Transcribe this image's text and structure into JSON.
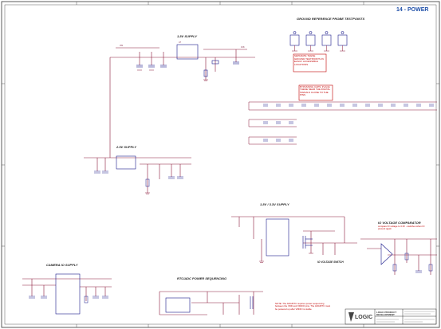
{
  "sheet": {
    "title": "14 - POWER",
    "border_color": "#333333",
    "wire_color": "#8b1a3a",
    "part_color": "#1a1a8b",
    "note_color": "#c00000",
    "title_color": "#1f4fa8"
  },
  "sections": {
    "supply_1_8v": "1.8V SUPPLY",
    "supply_2_5v": "2.5V SUPPLY",
    "supply_1_8v_3_3v": "1.8V / 3.3V SUPPLY",
    "camera_io": "CAMERA IO SUPPLY",
    "io_voltage_comparator": "IO VOLTAGE COMPARATOR",
    "io_voltage_switch": "IO VOLTAGE SWITCH",
    "rtc_power_seq": "RTC/ADC POWER SEQUENCING",
    "ground_reference": "GROUND REFERENCE PROBE TESTPOINTS"
  },
  "notes": {
    "ground_note": "SEPARATE THESE GROUND TESTPOINTS IN EASILY ACCESSIBLE LOCATIONS",
    "bypass_note": "BYPASSING CAPS: PLACE THESE NEAR THE DIGITAL SIGNALS CLOSE TO THE PINS",
    "comparator_note": "compare IO voltage to 3.3V - switches when IO present again",
    "sequencing_note": "NOTE: The ADC/RTC requires power sequencing between the VDD and VDDIO pins. The ADC/RTC must be powered up after VDDIO is stable."
  },
  "title_block": {
    "company": "LOGIC",
    "line1": "LOGIC PRODUCT",
    "line2": "DEVELOPMENT"
  },
  "border_zones": {
    "top": [
      "1",
      "2",
      "3",
      "4",
      "5",
      "6"
    ],
    "side": [
      "A",
      "B",
      "C",
      "D"
    ]
  }
}
